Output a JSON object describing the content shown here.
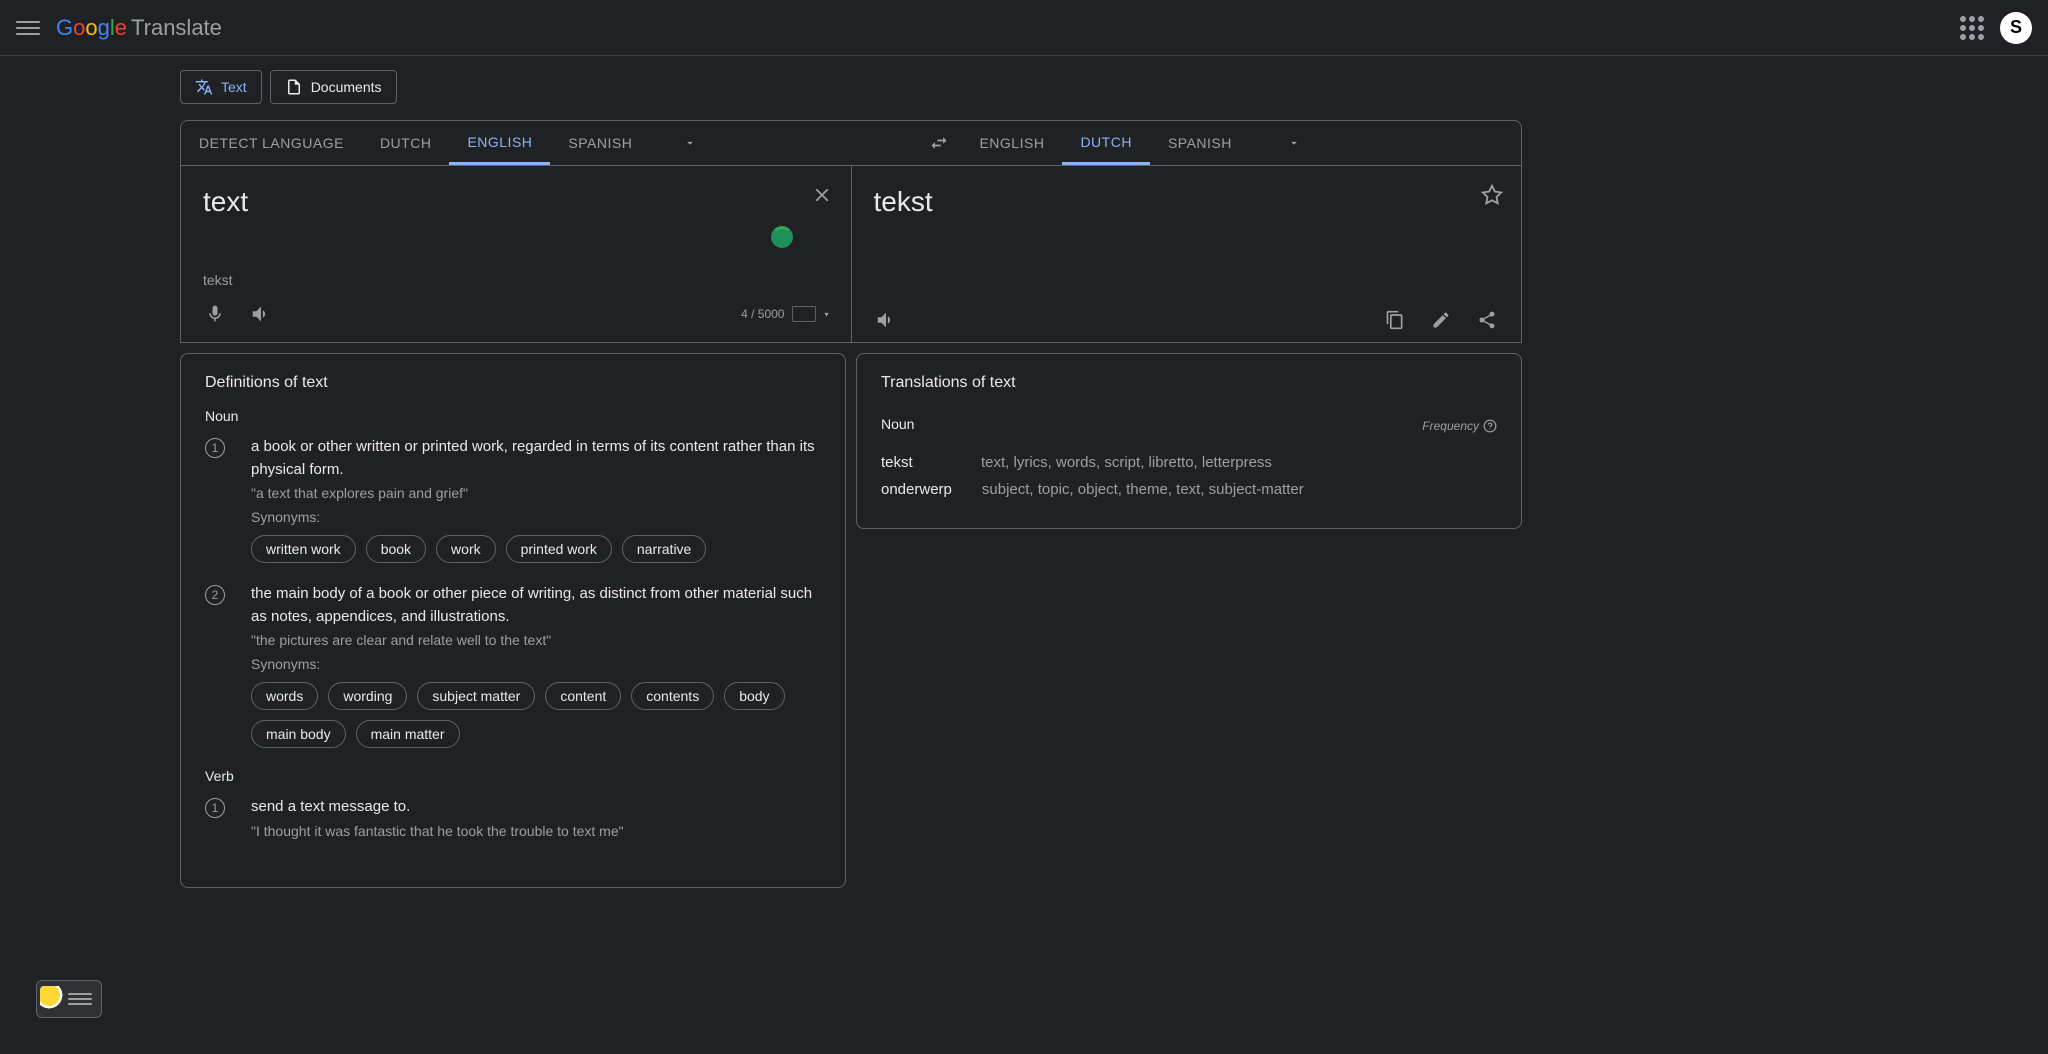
{
  "header": {
    "logo_translate": "Translate",
    "avatar_letter": "S"
  },
  "modes": {
    "text": "Text",
    "documents": "Documents"
  },
  "source_langs": {
    "detect": "DETECT LANGUAGE",
    "dutch": "DUTCH",
    "english": "ENGLISH",
    "spanish": "SPANISH"
  },
  "target_langs": {
    "english": "ENGLISH",
    "dutch": "DUTCH",
    "spanish": "SPANISH"
  },
  "input": {
    "text": "text",
    "suggestion": "tekst",
    "char_count": "4 / 5000"
  },
  "output": {
    "text": "tekst"
  },
  "definitions": {
    "title": "Definitions of text",
    "sections": [
      {
        "pos": "Noun",
        "items": [
          {
            "num": "1",
            "text": "a book or other written or printed work, regarded in terms of its content rather than its physical form.",
            "example": "\"a text that explores pain and grief\"",
            "syn_label": "Synonyms:",
            "syns": [
              "written work",
              "book",
              "work",
              "printed work",
              "narrative"
            ]
          },
          {
            "num": "2",
            "text": "the main body of a book or other piece of writing, as distinct from other material such as notes, appendices, and illustrations.",
            "example": "\"the pictures are clear and relate well to the text\"",
            "syn_label": "Synonyms:",
            "syns": [
              "words",
              "wording",
              "subject matter",
              "content",
              "contents",
              "body",
              "main body",
              "main matter"
            ]
          }
        ]
      },
      {
        "pos": "Verb",
        "items": [
          {
            "num": "1",
            "text": "send a text message to.",
            "example": "\"I thought it was fantastic that he took the trouble to text me\"",
            "syn_label": "",
            "syns": []
          }
        ]
      }
    ]
  },
  "translations": {
    "title": "Translations of text",
    "pos": "Noun",
    "frequency": "Frequency",
    "items": [
      {
        "term": "tekst",
        "syns": "text, lyrics, words, script, libretto, letterpress"
      },
      {
        "term": "onderwerp",
        "syns": "subject, topic, object, theme, text, subject-matter"
      }
    ]
  }
}
